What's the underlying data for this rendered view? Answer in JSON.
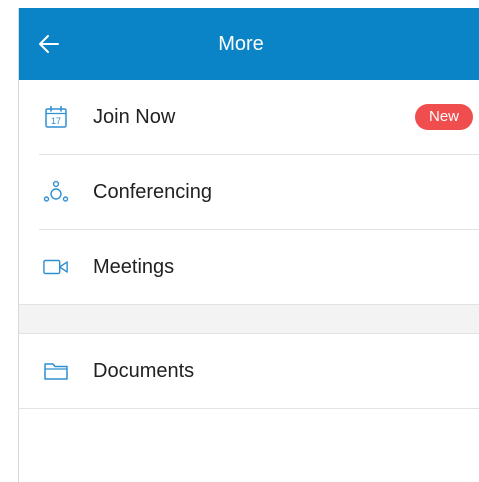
{
  "header": {
    "title": "More",
    "back_icon": "arrow-left-icon",
    "background_color": "#0a84c6"
  },
  "menu": {
    "items": [
      {
        "label": "Join Now",
        "icon": "calendar-icon",
        "icon_text": "17",
        "badge": "New"
      },
      {
        "label": "Conferencing",
        "icon": "conference-icon"
      },
      {
        "label": "Meetings",
        "icon": "video-camera-icon"
      },
      {
        "label": "Documents",
        "icon": "folder-icon"
      }
    ]
  },
  "colors": {
    "accent": "#0a84c6",
    "icon_blue": "#2f8fd0",
    "badge_red": "#f04e4e"
  }
}
